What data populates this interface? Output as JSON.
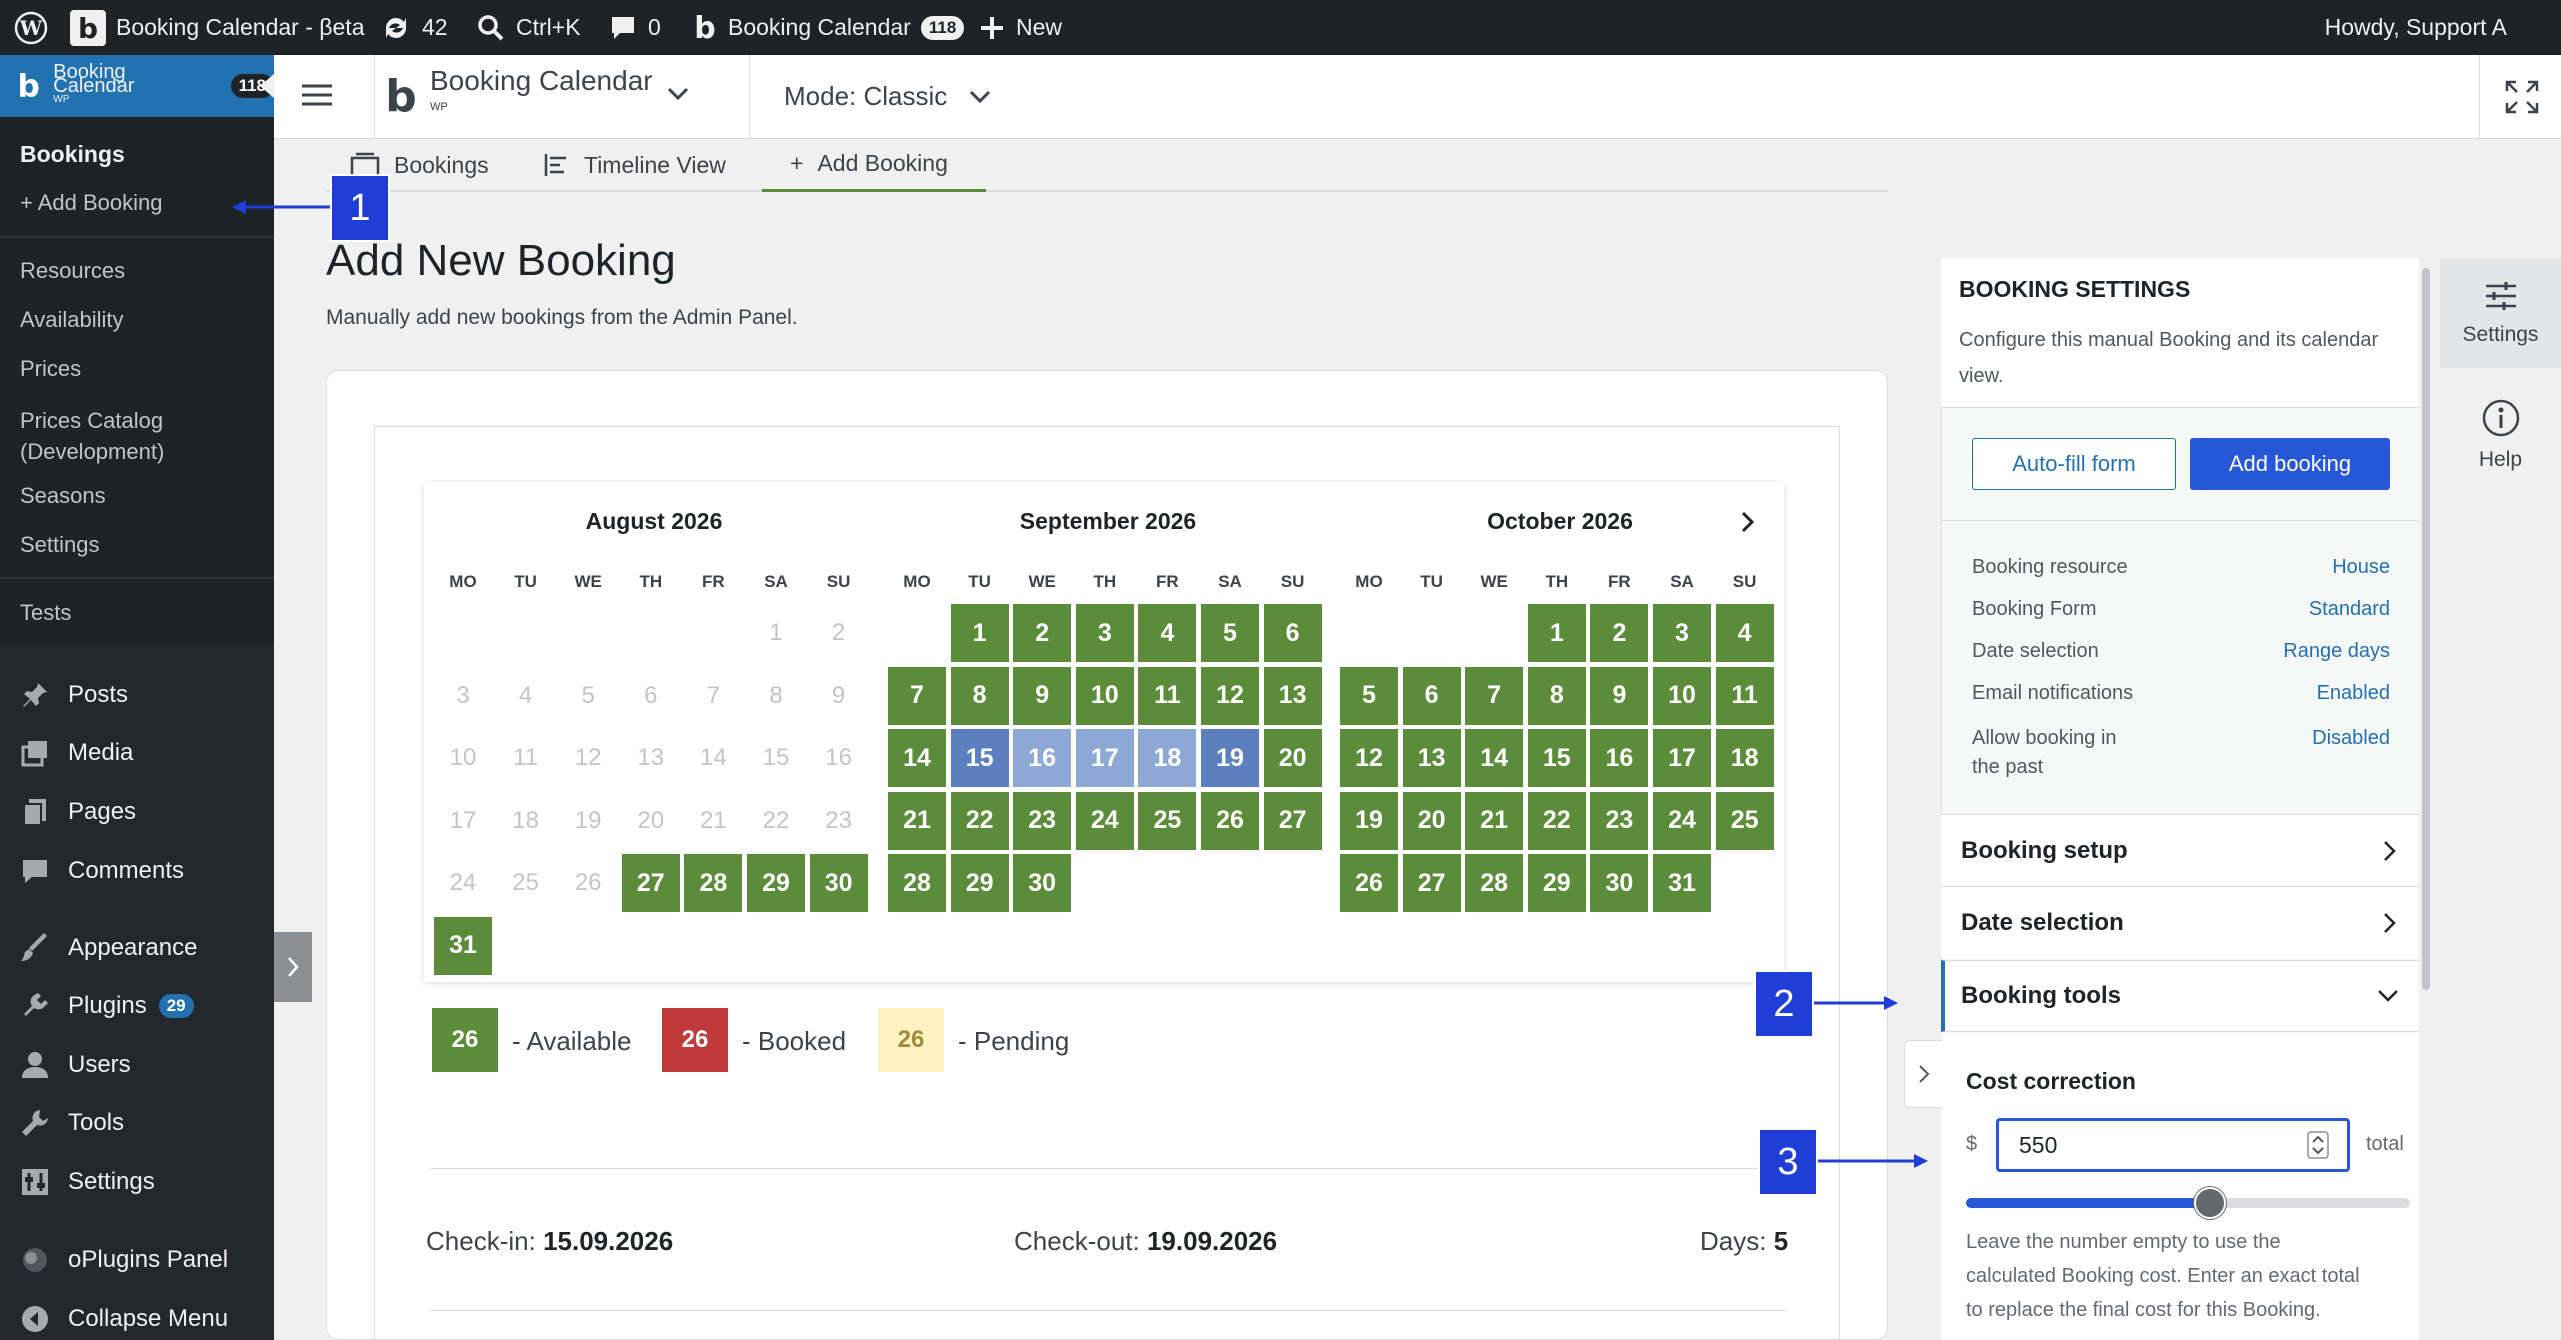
{
  "adminbar": {
    "site": "Booking Calendar - βeta",
    "updates": "42",
    "search": "Ctrl+K",
    "comments": "0",
    "plugin": "Booking Calendar",
    "plugin_badge": "118",
    "new": "New",
    "howdy": "Howdy, Support A"
  },
  "sidebar": {
    "brand": "Booking Calendar",
    "brand_sub": "WP",
    "brand_badge": "118",
    "bookings": "Bookings",
    "add_booking": "+ Add Booking",
    "resources": "Resources",
    "availability": "Availability",
    "prices": "Prices",
    "prices_catalog_1": "Prices Catalog",
    "prices_catalog_2": "(Development)",
    "seasons": "Seasons",
    "settings": "Settings",
    "tests": "Tests",
    "posts": "Posts",
    "media": "Media",
    "pages": "Pages",
    "comments": "Comments",
    "appearance": "Appearance",
    "plugins": "Plugins",
    "plugins_badge": "29",
    "users": "Users",
    "tools": "Tools",
    "settings2": "Settings",
    "oplugins": "oPlugins Panel",
    "collapse": "Collapse Menu"
  },
  "header": {
    "product": "Booking Calendar",
    "product_sub": "WP",
    "mode": "Mode: Classic"
  },
  "tabs": {
    "bookings": "Bookings",
    "timeline": "Timeline View",
    "add": "Add Booking",
    "add_plus": "+"
  },
  "page": {
    "title": "Add New Booking",
    "subtitle": "Manually add new bookings from the Admin Panel."
  },
  "calendar": {
    "weekdays": [
      "MO",
      "TU",
      "WE",
      "TH",
      "FR",
      "SA",
      "SU"
    ],
    "months": [
      {
        "title": "August 2026",
        "offset": 5,
        "days": 31,
        "available_from": 27,
        "selected": [],
        "selected_mid": []
      },
      {
        "title": "September 2026",
        "offset": 1,
        "days": 30,
        "available_from": 1,
        "selected": [
          15,
          19
        ],
        "selected_mid": [
          16,
          17,
          18
        ]
      },
      {
        "title": "October 2026",
        "offset": 3,
        "days": 31,
        "available_from": 1,
        "selected": [],
        "selected_mid": []
      }
    ],
    "legend": [
      {
        "num": "26",
        "label": "- Available",
        "color": "#5b8c3a",
        "text": "#ffffff"
      },
      {
        "num": "26",
        "label": "- Booked",
        "color": "#c0393b",
        "text": "#ffffff"
      },
      {
        "num": "26",
        "label": "- Pending",
        "color": "#fdf3c2",
        "text": "#a6883a"
      }
    ]
  },
  "summary": {
    "checkin_label": "Check-in:",
    "checkin": "15.09.2026",
    "checkout_label": "Check-out:",
    "checkout": "19.09.2026",
    "days_label": "Days:",
    "days": "5"
  },
  "settings": {
    "title": "BOOKING SETTINGS",
    "desc_1": "Configure this manual Booking and its calendar",
    "desc_2": "view.",
    "autofill": "Auto-fill form",
    "add": "Add booking",
    "rows": [
      {
        "label": "Booking resource",
        "value": "House"
      },
      {
        "label": "Booking Form",
        "value": "Standard"
      },
      {
        "label": "Date selection",
        "value": "Range days"
      },
      {
        "label": "Email notifications",
        "value": "Enabled"
      },
      {
        "label": "Allow booking in",
        "label2": "the past",
        "value": "Disabled"
      }
    ],
    "booking_setup": "Booking setup",
    "date_selection": "Date selection",
    "booking_tools": "Booking tools",
    "cost_title": "Cost correction",
    "currency": "$",
    "cost_value": "550",
    "total": "total",
    "slider_level": 0.55,
    "help_1": "Leave the number empty to use the",
    "help_2": "calculated Booking cost. Enter an exact total",
    "help_3": "to replace the final cost for this Booking."
  },
  "rail": {
    "settings": "Settings",
    "help": "Help"
  },
  "callouts": [
    "1",
    "2",
    "3"
  ],
  "colors": {
    "accent": "#2271b1",
    "available": "#5b8c3a",
    "callout": "#1f3ed8"
  }
}
